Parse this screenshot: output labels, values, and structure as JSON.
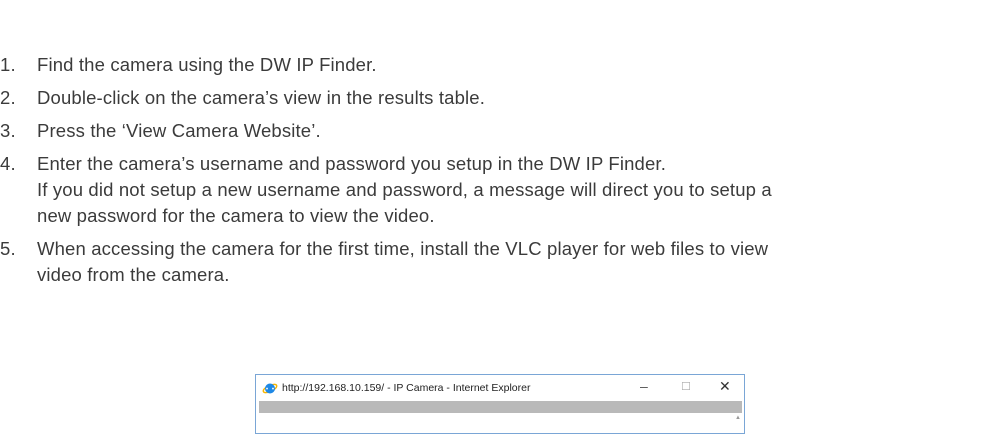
{
  "steps": [
    {
      "num": "1.",
      "lines": [
        "Find the camera using the DW IP Finder."
      ]
    },
    {
      "num": "2.",
      "lines": [
        "Double-click on the camera’s view in the results table."
      ]
    },
    {
      "num": "3.",
      "lines": [
        "Press the ‘View Camera Website’."
      ]
    },
    {
      "num": "4.",
      "lines": [
        "Enter the camera’s username and password you setup in the DW IP Finder.",
        "If you did not setup a new username and password, a message will direct you to setup a",
        "new password for the camera to view the video."
      ]
    },
    {
      "num": "5.",
      "lines": [
        "When accessing the camera for the first time, install the VLC player for web files to view",
        "video from the camera."
      ]
    }
  ],
  "browser": {
    "title": "http://192.168.10.159/ - IP Camera - Internet Explorer",
    "icon": "internet-explorer-icon",
    "minimize": "–",
    "maximize": "☐",
    "close": "✕",
    "scroll_arrow": "▲"
  },
  "colors": {
    "text": "#3b3b3b",
    "window_border": "#7aa6d6",
    "ie_blue": "#1e88e5",
    "ie_ring": "#f5b400"
  }
}
